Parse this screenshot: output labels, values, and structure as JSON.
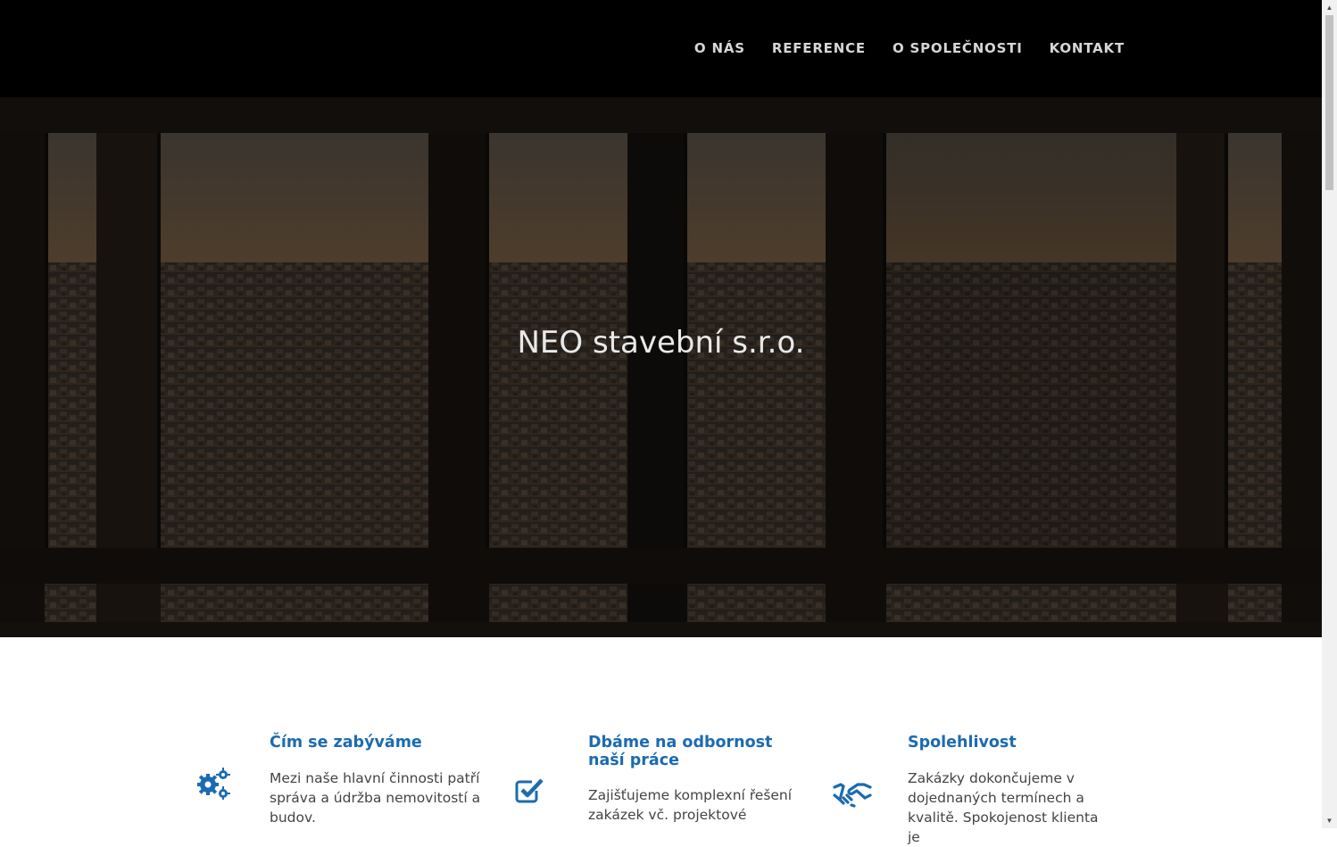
{
  "nav": {
    "items": [
      {
        "label": "O NÁS"
      },
      {
        "label": "REFERENCE"
      },
      {
        "label": "O SPOLEČNOSTI"
      },
      {
        "label": "KONTAKT"
      }
    ]
  },
  "hero": {
    "title": "NEO stavební s.r.o."
  },
  "features": [
    {
      "icon": "gears-icon",
      "title": "Čím se zabýváme",
      "text": "Mezi naše hlavní činnosti patří správa a údržba nemovitostí a budov."
    },
    {
      "icon": "checkbox-icon",
      "title": "Dbáme na odbornost naší práce",
      "text": "Zajišťujeme komplexní řešení zakázek vč. projektové"
    },
    {
      "icon": "handshake-icon",
      "title": "Spolehlivost",
      "text": "Zakázky dokončujeme v dojednaných termínech a kvalitě. Spokojenost klienta je"
    }
  ],
  "colors": {
    "accent": "#1c6bb0",
    "header_bg": "#000000",
    "nav_text": "#d6d6d6"
  }
}
